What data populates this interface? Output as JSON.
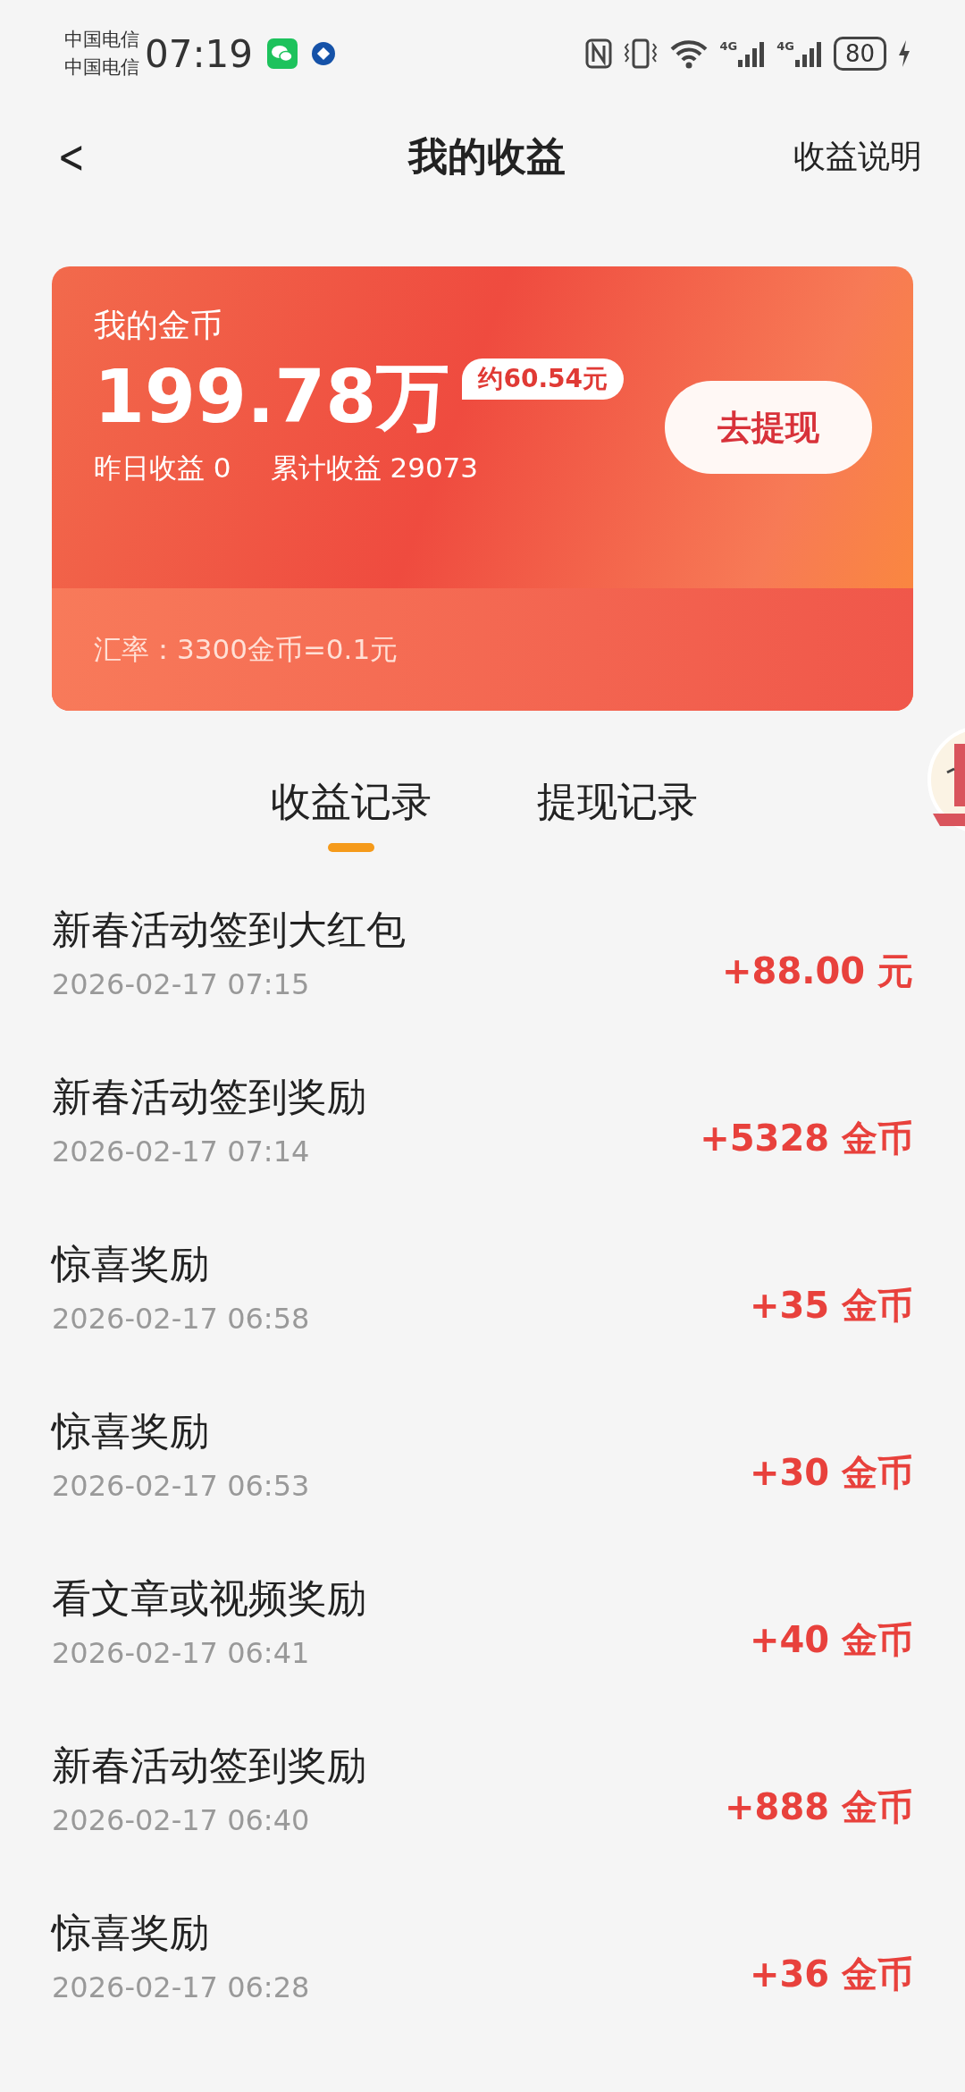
{
  "status_bar": {
    "carrier_1": "中国电信",
    "carrier_2": "中国电信",
    "time": "07:19",
    "network_1": "4G",
    "network_2": "4G",
    "battery": "80"
  },
  "header": {
    "back": "<",
    "title": "我的收益",
    "action": "收益说明"
  },
  "card": {
    "label": "我的金币",
    "amount": "199.78万",
    "approx": "约60.54元",
    "button": "去提现",
    "yesterday": "昨日收益 0",
    "total": "累计收益 29073",
    "rate": "汇率：3300金币=0.1元"
  },
  "tabs": [
    {
      "label": "收益记录",
      "selected": true
    },
    {
      "label": "提现记录",
      "selected": false
    }
  ],
  "records": [
    {
      "title": "新春活动签到大红包",
      "time": "2026-02-17 07:15",
      "amount": "+88.00 元"
    },
    {
      "title": "新春活动签到奖励",
      "time": "2026-02-17 07:14",
      "amount": "+5328 金币"
    },
    {
      "title": "惊喜奖励",
      "time": "2026-02-17 06:58",
      "amount": "+35 金币"
    },
    {
      "title": "惊喜奖励",
      "time": "2026-02-17 06:53",
      "amount": "+30 金币"
    },
    {
      "title": "看文章或视频奖励",
      "time": "2026-02-17 06:41",
      "amount": "+40 金币"
    },
    {
      "title": "新春活动签到奖励",
      "time": "2026-02-17 06:40",
      "amount": "+888 金币"
    },
    {
      "title": "惊喜奖励",
      "time": "2026-02-17 06:28",
      "amount": "+36 金币"
    }
  ]
}
